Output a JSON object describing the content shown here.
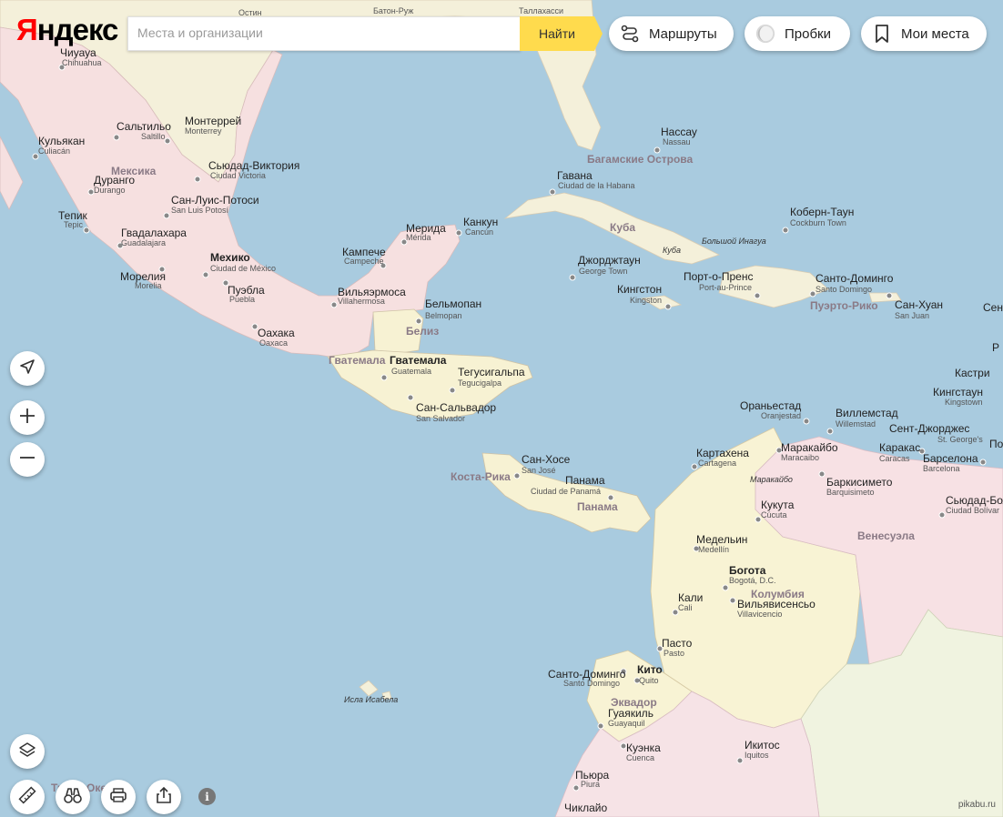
{
  "logo": {
    "first_letter": "Я",
    "rest": "ндекс"
  },
  "search": {
    "placeholder": "Места и организации",
    "button_label": "Найти"
  },
  "top_controls": {
    "routes_label": "Маршруты",
    "traffic_label": "Пробки",
    "my_places_label": "Мои места"
  },
  "map_controls": {
    "location_icon": "navigation-arrow-icon",
    "zoom_in_icon": "plus-icon",
    "zoom_out_icon": "minus-icon",
    "layers_icon": "layers-icon",
    "ruler_icon": "ruler-icon",
    "panorama_icon": "binoculars-icon",
    "print_icon": "printer-icon",
    "share_icon": "share-icon",
    "info_icon": "i"
  },
  "watermark": "pikabu.ru",
  "map_labels": {
    "top_partial": {
      "ostin": "Остин",
      "baton_rouge": "Батон-Руж",
      "tallahassee": "Таллахасси"
    },
    "cities": {
      "chihuahua": "Чиуауа",
      "chihuahua_sub": "Chihuahua",
      "saltillo": "Сальтильо",
      "saltillo_sub": "Saltillo",
      "monterrey": "Монтеррей",
      "monterrey_sub": "Monterrey",
      "culiacan": "Кульякан",
      "culiacan_sub": "Culiacán",
      "victoria": "Сьюдад-Виктория",
      "victoria_sub": "Ciudad Victoria",
      "durango": "Дуранго",
      "durango_sub": "Durango",
      "slp": "Сан-Луис-Потоси",
      "slp_sub": "San Luis Potosí",
      "tepic": "Тепик",
      "tepic_sub": "Tepic",
      "guadalajara": "Гвадалахара",
      "guadalajara_sub": "Guadalajara",
      "mexico": "Мехико",
      "mexico_sub": "Ciudad de México",
      "morelia": "Морелия",
      "morelia_sub": "Morelia",
      "puebla": "Пуэбла",
      "puebla_sub": "Puebla",
      "oaxaca": "Оахака",
      "oaxaca_sub": "Oaxaca",
      "merida": "Мерида",
      "merida_sub": "Mérida",
      "cancun": "Канкун",
      "cancun_sub": "Cancún",
      "campeche": "Кампече",
      "campeche_sub": "Campeche",
      "villahermosa": "Вильяэрмоса",
      "villahermosa_sub": "Villahermosa",
      "belmopan": "Бельмопан",
      "belmopan_sub": "Belmopan",
      "guatemala_city": "Гватемала",
      "guatemala_city_sub": "Guatemala",
      "tegucigalpa": "Тегусигальпа",
      "tegucigalpa_sub": "Tegucigalpa",
      "san_salvador": "Сан-Сальвадор",
      "san_salvador_sub": "San Salvador",
      "nassau": "Нассау",
      "nassau_sub": "Nassau",
      "havana": "Гавана",
      "havana_sub": "Ciudad de la Habana",
      "cockburn": "Коберн-Таун",
      "cockburn_sub": "Cockburn Town",
      "george_town": "Джорджтаун",
      "george_town_sub": "George Town",
      "kingston": "Кингстон",
      "kingston_sub": "Kingston",
      "port_au_prince": "Порт-о-Пренс",
      "port_au_prince_sub": "Port-au-Prince",
      "santo_domingo": "Санто-Доминго",
      "santo_domingo_sub": "Santo Domingo",
      "san_juan": "Сан-Хуан",
      "san_juan_sub": "San Juan",
      "castries": "Кастри",
      "kingstown": "Кингстаун",
      "kingstown_sub": "Kingstown",
      "oranjestad": "Ораньестад",
      "oranjestad_sub": "Oranjestad",
      "willemstad": "Виллемстад",
      "willemstad_sub": "Willemstad",
      "st_georges": "Сент-Джорджес",
      "st_georges_sub": "St. George's",
      "cartagena": "Картахена",
      "cartagena_sub": "Cartagena",
      "maracaibo": "Маракайбо",
      "maracaibo_sub": "Maracaibo",
      "caracas": "Каракас",
      "caracas_sub": "Caracas",
      "barcelona": "Барселона",
      "barcelona_sub": "Barcelona",
      "barquisimeto": "Баркисимето",
      "barquisimeto_sub": "Barquisimeto",
      "san_jose": "Сан-Хосе",
      "san_jose_sub": "San José",
      "panama_city": "Панама",
      "panama_city_sub": "Ciudad de Panamá",
      "cucuta": "Кукута",
      "cucuta_sub": "Cúcuta",
      "bolivar": "Сьюдад-Боли",
      "bolivar_sub": "Ciudad Bolívar",
      "medellin": "Медельин",
      "medellin_sub": "Medellín",
      "bogota": "Богота",
      "bogota_sub": "Bogotá, D.C.",
      "cali": "Кали",
      "cali_sub": "Cali",
      "villavicencio": "Вильявисенсьо",
      "villavicencio_sub": "Villavicencio",
      "pasto": "Пасто",
      "pasto_sub": "Pasto",
      "quito": "Кито",
      "quito_sub": "Quito",
      "santo_domingo_ec": "Санто-Доминго",
      "santo_domingo_ec_sub": "Santo Domingo",
      "guayaquil": "Гуаякиль",
      "guayaquil_sub": "Guayaquil",
      "cuenca": "Куэнка",
      "cuenca_sub": "Cuenca",
      "iquitos": "Икитос",
      "iquitos_sub": "Iquitos",
      "piura": "Пьюра",
      "piura_sub": "Piura",
      "chiclayo": "Чиклайо",
      "sen_partial": "Сен",
      "p_partial": "По",
      "r_partial": "Р"
    },
    "countries": {
      "mexico": "Мексика",
      "belize": "Белиз",
      "guatemala": "Гватемала",
      "cuba": "Куба",
      "bahamas": "Багамские Острова",
      "puerto_rico": "Пуэрто-Рико",
      "costa_rica": "Коста-Рика",
      "panama": "Панама",
      "venezuela": "Венесуэла",
      "colombia": "Колумбия",
      "ecuador": "Эквадор"
    },
    "features": {
      "cuba_island": "Куба",
      "great_inagua": "Большой Инагуа",
      "lake_maracaibo": "Маракайбо",
      "isabela": "Исла Исабела",
      "pacific_partial": "Тихий Оке"
    }
  },
  "colors": {
    "water": "#a9cbdf",
    "mexico": "#f6e0e0",
    "usa": "#f4f0da",
    "central_america": "#f7f2d3",
    "colombia": "#f8f3d4",
    "venezuela": "#f7e1e4",
    "peru": "#f6e3e6",
    "brazil": "#f0f3e0",
    "accent": "#ffdb4d",
    "logo_red": "#ff0000"
  }
}
